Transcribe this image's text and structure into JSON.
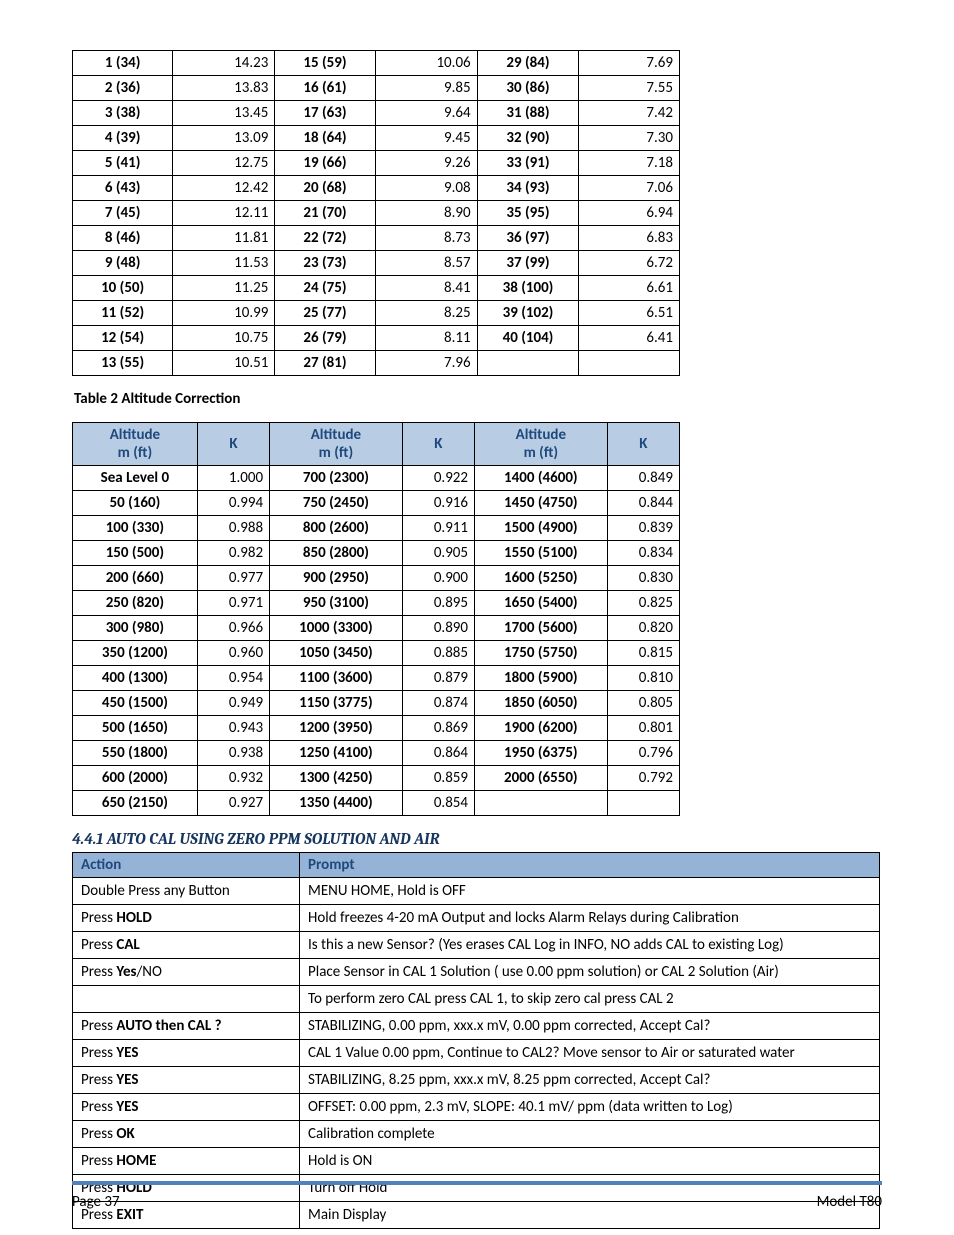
{
  "table1": {
    "rows": [
      [
        "1 (34)",
        "14.23",
        "15 (59)",
        "10.06",
        "29 (84)",
        "7.69"
      ],
      [
        "2 (36)",
        "13.83",
        "16 (61)",
        "9.85",
        "30 (86)",
        "7.55"
      ],
      [
        "3 (38)",
        "13.45",
        "17 (63)",
        "9.64",
        "31 (88)",
        "7.42"
      ],
      [
        "4 (39)",
        "13.09",
        "18 (64)",
        "9.45",
        "32 (90)",
        "7.30"
      ],
      [
        "5 (41)",
        "12.75",
        "19 (66)",
        "9.26",
        "33 (91)",
        "7.18"
      ],
      [
        "6 (43)",
        "12.42",
        "20 (68)",
        "9.08",
        "34 (93)",
        "7.06"
      ],
      [
        "7 (45)",
        "12.11",
        "21 (70)",
        "8.90",
        "35 (95)",
        "6.94"
      ],
      [
        "8 (46)",
        "11.81",
        "22 (72)",
        "8.73",
        "36 (97)",
        "6.83"
      ],
      [
        "9 (48)",
        "11.53",
        "23 (73)",
        "8.57",
        "37 (99)",
        "6.72"
      ],
      [
        "10 (50)",
        "11.25",
        "24 (75)",
        "8.41",
        "38 (100)",
        "6.61"
      ],
      [
        "11 (52)",
        "10.99",
        "25 (77)",
        "8.25",
        "39 (102)",
        "6.51"
      ],
      [
        "12 (54)",
        "10.75",
        "26 (79)",
        "8.11",
        "40 (104)",
        "6.41"
      ],
      [
        "13 (55)",
        "10.51",
        "27 (81)",
        "7.96",
        "",
        ""
      ]
    ]
  },
  "table2_caption": "Table 2   Altitude Correction",
  "table2": {
    "head_top": [
      "Altitude",
      "K",
      "Altitude",
      "K",
      "Altitude",
      "K"
    ],
    "head_sub": "m (ft)",
    "rows": [
      [
        "Sea Level 0",
        "1.000",
        "700 (2300)",
        "0.922",
        "1400 (4600)",
        "0.849"
      ],
      [
        "50 (160)",
        "0.994",
        "750 (2450)",
        "0.916",
        "1450 (4750)",
        "0.844"
      ],
      [
        "100 (330)",
        "0.988",
        "800 (2600)",
        "0.911",
        "1500 (4900)",
        "0.839"
      ],
      [
        "150 (500)",
        "0.982",
        "850 (2800)",
        "0.905",
        "1550 (5100)",
        "0.834"
      ],
      [
        "200 (660)",
        "0.977",
        "900 (2950)",
        "0.900",
        "1600 (5250)",
        "0.830"
      ],
      [
        "250 (820)",
        "0.971",
        "950 (3100)",
        "0.895",
        "1650 (5400)",
        "0.825"
      ],
      [
        "300 (980)",
        "0.966",
        "1000 (3300)",
        "0.890",
        "1700 (5600)",
        "0.820"
      ],
      [
        "350 (1200)",
        "0.960",
        "1050 (3450)",
        "0.885",
        "1750 (5750)",
        "0.815"
      ],
      [
        "400 (1300)",
        "0.954",
        "1100 (3600)",
        "0.879",
        "1800 (5900)",
        "0.810"
      ],
      [
        "450 (1500)",
        "0.949",
        "1150 (3775)",
        "0.874",
        "1850 (6050)",
        "0.805"
      ],
      [
        "500 (1650)",
        "0.943",
        "1200 (3950)",
        "0.869",
        "1900 (6200)",
        "0.801"
      ],
      [
        "550 (1800)",
        "0.938",
        "1250 (4100)",
        "0.864",
        "1950 (6375)",
        "0.796"
      ],
      [
        "600 (2000)",
        "0.932",
        "1300 (4250)",
        "0.859",
        "2000 (6550)",
        "0.792"
      ],
      [
        "650 (2150)",
        "0.927",
        "1350 (4400)",
        "0.854",
        "",
        ""
      ]
    ]
  },
  "section_title": "4.4.1 AUTO CAL USING ZERO PPM SOLUTION AND AIR",
  "table3": {
    "head": [
      "Action",
      "Prompt"
    ],
    "rows": [
      {
        "action": "Double Press any Button",
        "bold": "",
        "prompt": "MENU HOME, Hold is OFF"
      },
      {
        "action": "Press ",
        "bold": "HOLD",
        "prompt": "Hold freezes 4-20 mA Output and locks Alarm Relays during Calibration"
      },
      {
        "action": "Press ",
        "bold": "CAL",
        "prompt": "Is this a new Sensor?  (Yes erases CAL Log in INFO, NO adds CAL to existing Log)"
      },
      {
        "action": "Press ",
        "bold": "Yes",
        "suffix": "/NO",
        "prompt": "Place Sensor in CAL 1 Solution ( use 0.00 ppm solution) or CAL 2 Solution (Air)"
      },
      {
        "action": "",
        "bold": "",
        "prompt": "To perform zero CAL press CAL 1, to skip zero cal press CAL 2"
      },
      {
        "action": "Press ",
        "bold": "AUTO then CAL ?",
        "prompt": "STABILIZING, 0.00 ppm, xxx.x mV, 0.00 ppm corrected, Accept Cal?"
      },
      {
        "action": "Press ",
        "bold": "YES",
        "prompt": "CAL 1 Value 0.00 ppm, Continue to CAL2? Move sensor to Air or saturated water"
      },
      {
        "action": "Press ",
        "bold": "YES",
        "prompt": "STABILIZING, 8.25 ppm, xxx.x mV, 8.25 ppm corrected, Accept Cal?"
      },
      {
        "action": "Press ",
        "bold": "YES",
        "prompt": "OFFSET:  0.00 ppm, 2.3 mV, SLOPE: 40.1 mV/ ppm (data written to Log)"
      },
      {
        "action": "Press ",
        "bold": "OK",
        "prompt": "Calibration complete"
      },
      {
        "action": "Press ",
        "bold": "HOME",
        "prompt": "Hold is ON"
      },
      {
        "action": "Press ",
        "bold": "HOLD",
        "prompt": "Turn off Hold"
      },
      {
        "action": "Press ",
        "bold": "EXIT",
        "prompt": "Main Display"
      }
    ]
  },
  "footer": {
    "left": "Page 37",
    "right": "Model T80"
  }
}
